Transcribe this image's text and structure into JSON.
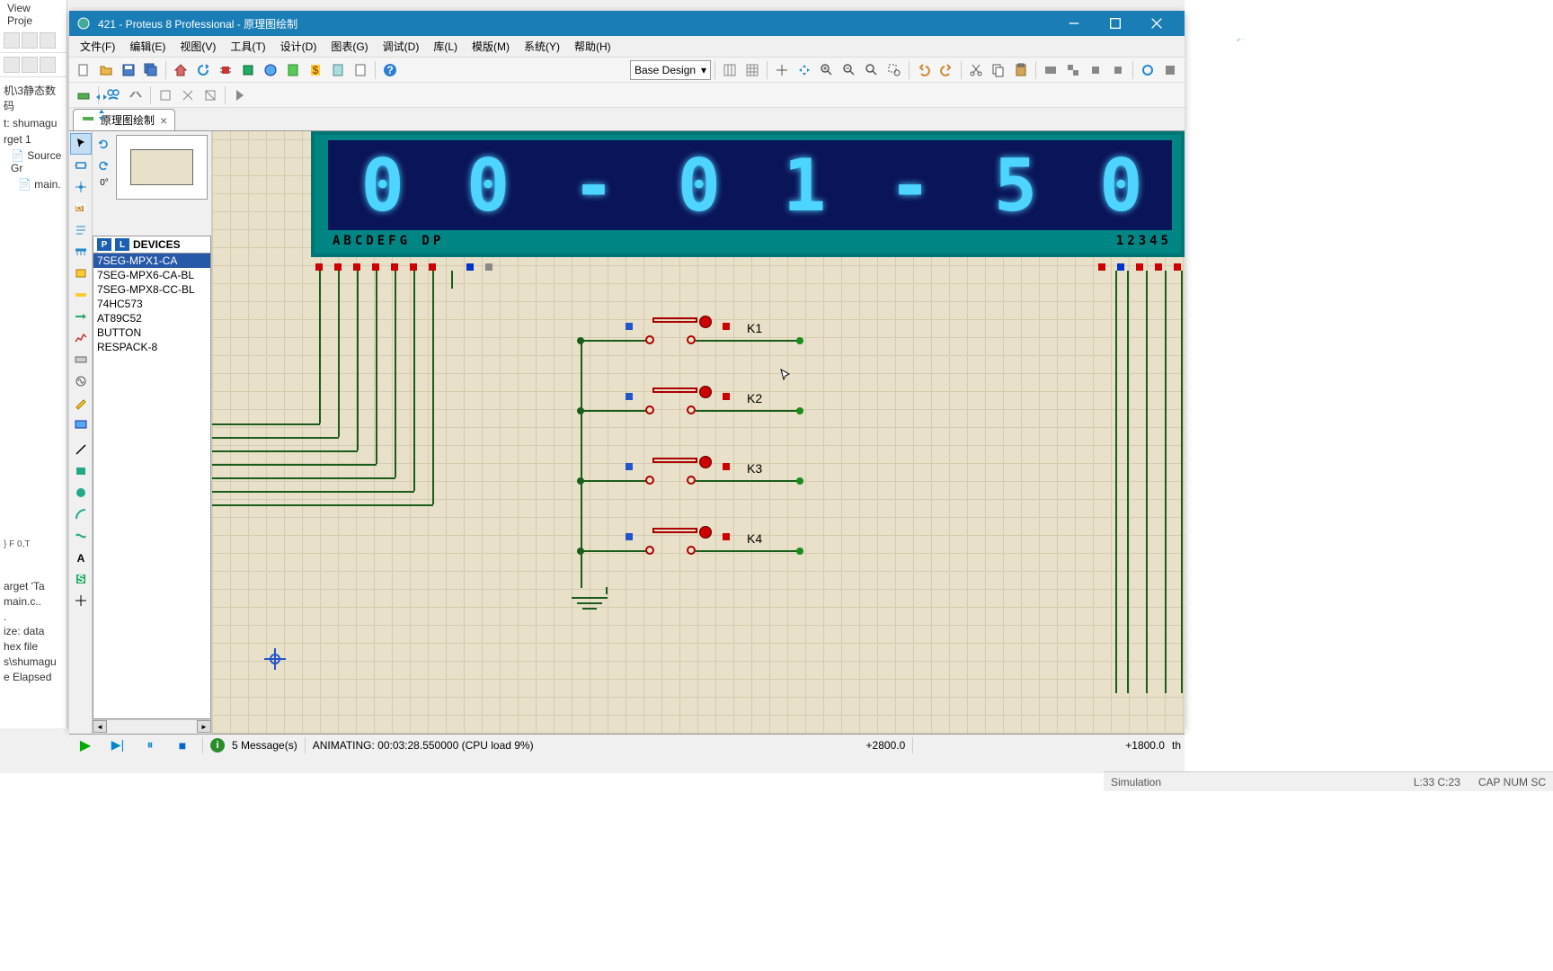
{
  "bg_left": {
    "menu_items": [
      "View",
      "Proje"
    ],
    "tree": [
      "机\\3静态数码",
      "t: shumagu",
      "rget 1",
      "Source Gr",
      "main."
    ],
    "output": [
      "arget 'Ta",
      " main.c..",
      ".",
      "ize: data",
      "hex file",
      "s\\shumagu",
      "e Elapsed"
    ],
    "footer": "} F  0,T"
  },
  "bg_status": {
    "sim": "Simulation",
    "pos": "L:33 C:23",
    "ind": "CAP  NUM  SC"
  },
  "titlebar": {
    "title": "421 - Proteus 8 Professional - 原理图绘制"
  },
  "menubar": [
    "文件(F)",
    "编辑(E)",
    "视图(V)",
    "工具(T)",
    "设计(D)",
    "图表(G)",
    "调试(D)",
    "库(L)",
    "模版(M)",
    "系统(Y)",
    "帮助(H)"
  ],
  "toolbar1": {
    "design_combo": "Base Design"
  },
  "tab": {
    "label": "原理图绘制"
  },
  "left_panel": {
    "angle": "0°",
    "header": "DEVICES",
    "items": [
      "7SEG-MPX1-CA",
      "7SEG-MPX6-CA-BL",
      "7SEG-MPX8-CC-BL",
      "74HC573",
      "AT89C52",
      "BUTTON",
      "RESPACK-8"
    ]
  },
  "display": {
    "digits": [
      "0",
      "0",
      "-",
      "0",
      "1",
      "-",
      "5",
      "0"
    ],
    "left_label": "ABCDEFG DP",
    "right_label": "12345"
  },
  "switches": [
    {
      "label": "K1"
    },
    {
      "label": "K2"
    },
    {
      "label": "K3"
    },
    {
      "label": "K4"
    }
  ],
  "statusbar": {
    "messages": "5 Message(s)",
    "anim": "ANIMATING: 00:03:28.550000 (CPU load 9%)",
    "coord_x": "+2800.0",
    "coord_y": "+1800.0",
    "coord_th": "th"
  }
}
